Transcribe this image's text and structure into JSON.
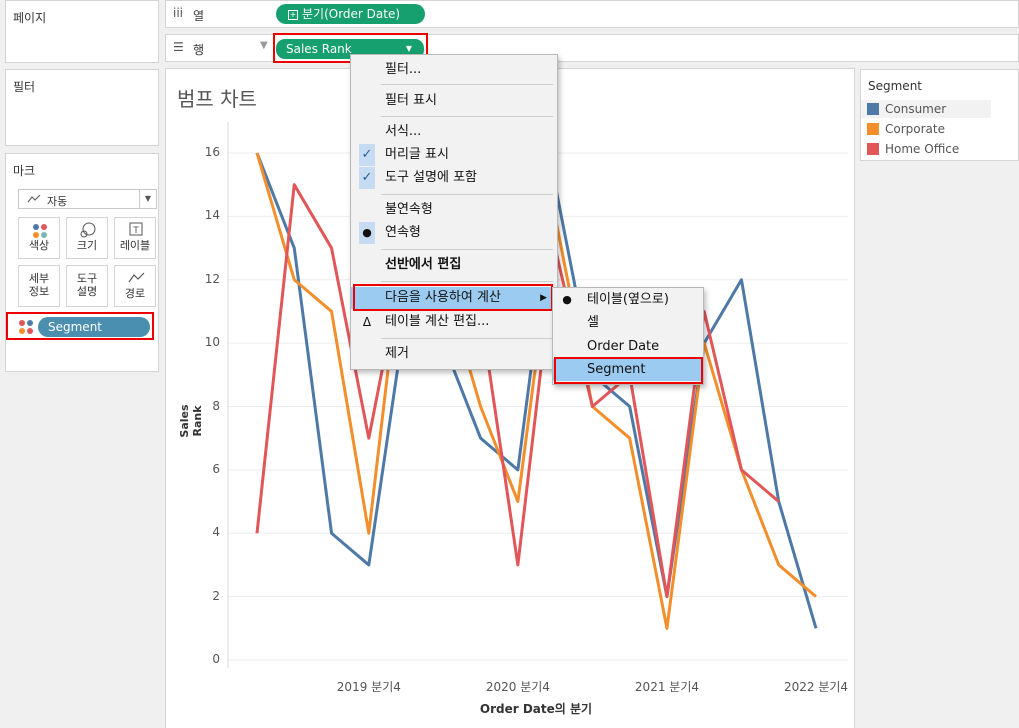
{
  "sidebar": {
    "pages_title": "페이지",
    "filters_title": "필터",
    "marks_title": "마크",
    "mark_type": "자동",
    "mark_buttons": [
      "색상",
      "크기",
      "레이블",
      "세부\n정보",
      "도구\n설명",
      "경로"
    ],
    "mark_pill": "Segment"
  },
  "shelves": {
    "columns_label": "열",
    "columns_pill": "분기(Order Date)",
    "rows_label": "행",
    "rows_pill": "Sales Rank"
  },
  "sheet": {
    "title": "범프 차트"
  },
  "legend": {
    "title": "Segment",
    "items": [
      {
        "label": "Consumer",
        "color": "#4e79a7"
      },
      {
        "label": "Corporate",
        "color": "#f28e2b"
      },
      {
        "label": "Home Office",
        "color": "#e15759"
      }
    ]
  },
  "chart_data": {
    "type": "line",
    "title": "범프 차트",
    "xlabel": "Order Date의 분기",
    "ylabel": "Sales Rank",
    "ylim": [
      0,
      17
    ],
    "yticks": [
      0,
      2,
      4,
      6,
      8,
      10,
      12,
      14,
      16
    ],
    "xtick_labels": [
      "2019 분기4",
      "2020 분기4",
      "2021 분기4",
      "2022 분기4"
    ],
    "x": [
      "2019 분기1",
      "2019 분기2",
      "2019 분기3",
      "2019 분기4",
      "2020 분기1",
      "2020 분기2",
      "2020 분기3",
      "2020 분기4",
      "2021 분기1",
      "2021 분기2",
      "2021 분기3",
      "2021 분기4",
      "2022 분기1",
      "2022 분기2",
      "2022 분기3",
      "2022 분기4"
    ],
    "series": [
      {
        "name": "Consumer",
        "color": "#4e79a7",
        "values": [
          16,
          13,
          4,
          3,
          11,
          10,
          7,
          6,
          15,
          9,
          8,
          2,
          10,
          12,
          5,
          1
        ]
      },
      {
        "name": "Corporate",
        "color": "#f28e2b",
        "values": [
          16,
          12,
          11,
          4,
          14,
          12,
          8,
          5,
          14,
          8,
          7,
          1,
          10,
          6,
          3,
          2
        ]
      },
      {
        "name": "Home Office",
        "color": "#e15759",
        "values": [
          4,
          15,
          13,
          7,
          13,
          14,
          11,
          3,
          13,
          8,
          9,
          2,
          11,
          6,
          5
        ]
      }
    ],
    "grid": true,
    "legend_position": "right"
  },
  "context_menu": {
    "items": [
      "필터...",
      "필터 표시",
      "서식...",
      "머리글 표시",
      "도구 설명에 포함",
      "불연속형",
      "연속형",
      "선반에서 편집",
      "다음을 사용하여 계산",
      "테이블 계산 편집...",
      "제거"
    ],
    "submenu": [
      "테이블(옆으로)",
      "셀",
      "Order Date",
      "Segment"
    ]
  }
}
